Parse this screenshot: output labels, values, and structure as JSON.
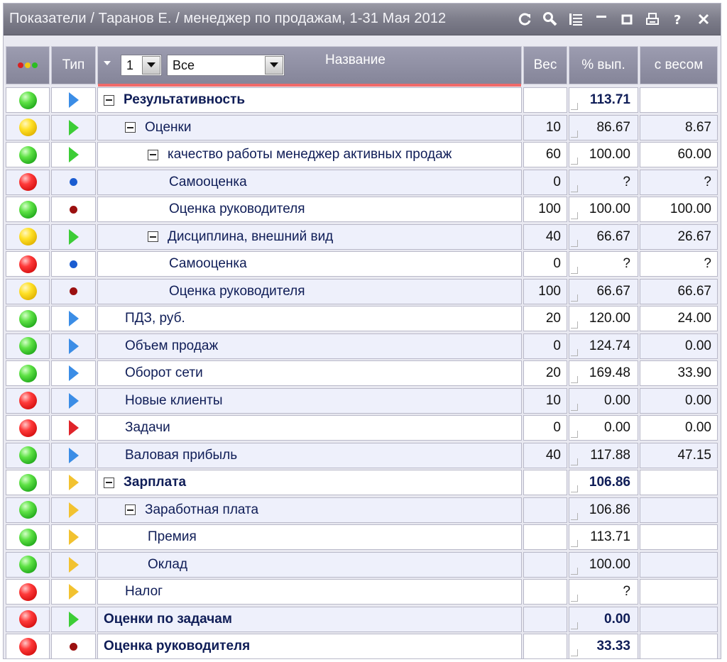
{
  "window": {
    "title": "Показатели / Таранов Е. / менеджер по продажам, 1-31 Мая 2012",
    "toolbar_icons": [
      "refresh-icon",
      "search-icon",
      "list-icon",
      "minimize-icon",
      "maximize-icon",
      "print-icon",
      "help-icon",
      "close-icon"
    ]
  },
  "header": {
    "status_col": "",
    "type_col": "Тип",
    "level_select": "1",
    "filter_select": "Все",
    "name_col": "Название",
    "weight_col": "Вес",
    "pct_col": "% вып.",
    "weighted_col": "с весом"
  },
  "colors": {
    "green": "#2bbd22",
    "yellow": "#f0c814",
    "red": "#e11a1a",
    "header_bg": "#8f8fa3",
    "text": "#0f1d57"
  },
  "rows": [
    {
      "status": "green",
      "type": "tri-blue",
      "name": "Результативность",
      "indent": 0,
      "expand": true,
      "bold": true,
      "weight": "",
      "pct": "113.71",
      "weighted": ""
    },
    {
      "status": "yellow",
      "type": "tri-green",
      "name": "Оценки",
      "indent": 1,
      "expand": true,
      "bold": false,
      "weight": "10",
      "pct": "86.67",
      "weighted": "8.67"
    },
    {
      "status": "green",
      "type": "tri-green",
      "name": "качество работы менеджер активных продаж",
      "indent": 2,
      "expand": true,
      "bold": false,
      "weight": "60",
      "pct": "100.00",
      "weighted": "60.00"
    },
    {
      "status": "red",
      "type": "dot-blue",
      "name": "Самооценка",
      "indent": 3,
      "expand": false,
      "bold": false,
      "weight": "0",
      "pct": "?",
      "weighted": "?"
    },
    {
      "status": "green",
      "type": "dot-darkred",
      "name": "Оценка руководителя",
      "indent": 3,
      "expand": false,
      "bold": false,
      "weight": "100",
      "pct": "100.00",
      "weighted": "100.00"
    },
    {
      "status": "yellow",
      "type": "tri-green",
      "name": "Дисциплина, внешний вид",
      "indent": 2,
      "expand": true,
      "bold": false,
      "weight": "40",
      "pct": "66.67",
      "weighted": "26.67"
    },
    {
      "status": "red",
      "type": "dot-blue",
      "name": "Самооценка",
      "indent": 3,
      "expand": false,
      "bold": false,
      "weight": "0",
      "pct": "?",
      "weighted": "?"
    },
    {
      "status": "yellow",
      "type": "dot-darkred",
      "name": "Оценка руководителя",
      "indent": 3,
      "expand": false,
      "bold": false,
      "weight": "100",
      "pct": "66.67",
      "weighted": "66.67"
    },
    {
      "status": "green",
      "type": "tri-blue",
      "name": "ПДЗ, руб.",
      "indent": 1,
      "expand": false,
      "bold": false,
      "weight": "20",
      "pct": "120.00",
      "weighted": "24.00"
    },
    {
      "status": "green",
      "type": "tri-blue",
      "name": "Объем продаж",
      "indent": 1,
      "expand": false,
      "bold": false,
      "weight": "0",
      "pct": "124.74",
      "weighted": "0.00"
    },
    {
      "status": "green",
      "type": "tri-blue",
      "name": "Оборот сети",
      "indent": 1,
      "expand": false,
      "bold": false,
      "weight": "20",
      "pct": "169.48",
      "weighted": "33.90"
    },
    {
      "status": "red",
      "type": "tri-blue",
      "name": "Новые клиенты",
      "indent": 1,
      "expand": false,
      "bold": false,
      "weight": "10",
      "pct": "0.00",
      "weighted": "0.00"
    },
    {
      "status": "red",
      "type": "tri-red",
      "name": "Задачи",
      "indent": 1,
      "expand": false,
      "bold": false,
      "weight": "0",
      "pct": "0.00",
      "weighted": "0.00"
    },
    {
      "status": "green",
      "type": "tri-blue",
      "name": "Валовая прибыль",
      "indent": 1,
      "expand": false,
      "bold": false,
      "weight": "40",
      "pct": "117.88",
      "weighted": "47.15"
    },
    {
      "status": "green",
      "type": "tri-yellow",
      "name": "Зарплата",
      "indent": 0,
      "expand": true,
      "bold": true,
      "weight": "",
      "pct": "106.86",
      "weighted": ""
    },
    {
      "status": "green",
      "type": "tri-yellow",
      "name": "Заработная плата",
      "indent": 1,
      "expand": true,
      "bold": false,
      "weight": "",
      "pct": "106.86",
      "weighted": ""
    },
    {
      "status": "green",
      "type": "tri-yellow",
      "name": "Премия",
      "indent": 2,
      "expand": false,
      "bold": false,
      "weight": "",
      "pct": "113.71",
      "weighted": ""
    },
    {
      "status": "green",
      "type": "tri-yellow",
      "name": "Оклад",
      "indent": 2,
      "expand": false,
      "bold": false,
      "weight": "",
      "pct": "100.00",
      "weighted": ""
    },
    {
      "status": "red",
      "type": "tri-yellow",
      "name": "Налог",
      "indent": 1,
      "expand": false,
      "bold": false,
      "weight": "",
      "pct": "?",
      "weighted": ""
    },
    {
      "status": "red",
      "type": "tri-green",
      "name": "Оценки по задачам",
      "indent": 0,
      "expand": false,
      "bold": true,
      "weight": "",
      "pct": "0.00",
      "weighted": ""
    },
    {
      "status": "red",
      "type": "dot-darkred",
      "name": "Оценка руководителя",
      "indent": 0,
      "expand": false,
      "bold": true,
      "weight": "",
      "pct": "33.33",
      "weighted": ""
    }
  ]
}
